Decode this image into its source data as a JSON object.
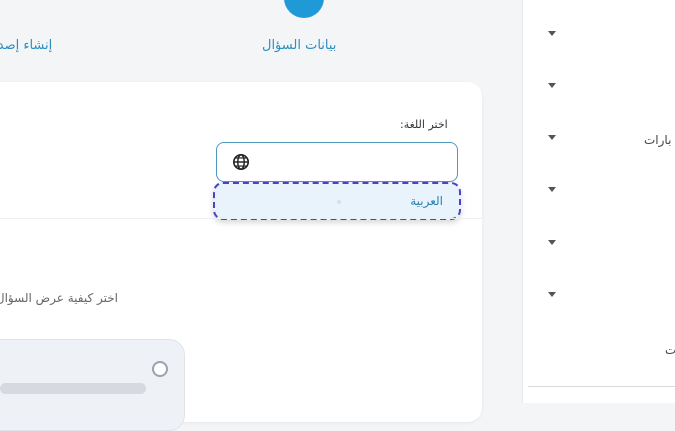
{
  "stepper": {
    "current_step_label": "بيانات السؤال",
    "next_step_label": "إنشاء إصدارات"
  },
  "language": {
    "label": "اختر اللغة:",
    "selected_value": "",
    "options": [
      "العربية"
    ]
  },
  "display": {
    "label": "اختر كيفية عرض السؤال"
  },
  "sidebar": {
    "visible_texts": [
      "بارات",
      "ت"
    ]
  },
  "colors": {
    "accent": "#1f9ad6",
    "focus_dashed": "#4b43c6",
    "option_text": "#2a7fb0"
  },
  "icons": [
    "globe-icon",
    "caret-down-icon"
  ]
}
